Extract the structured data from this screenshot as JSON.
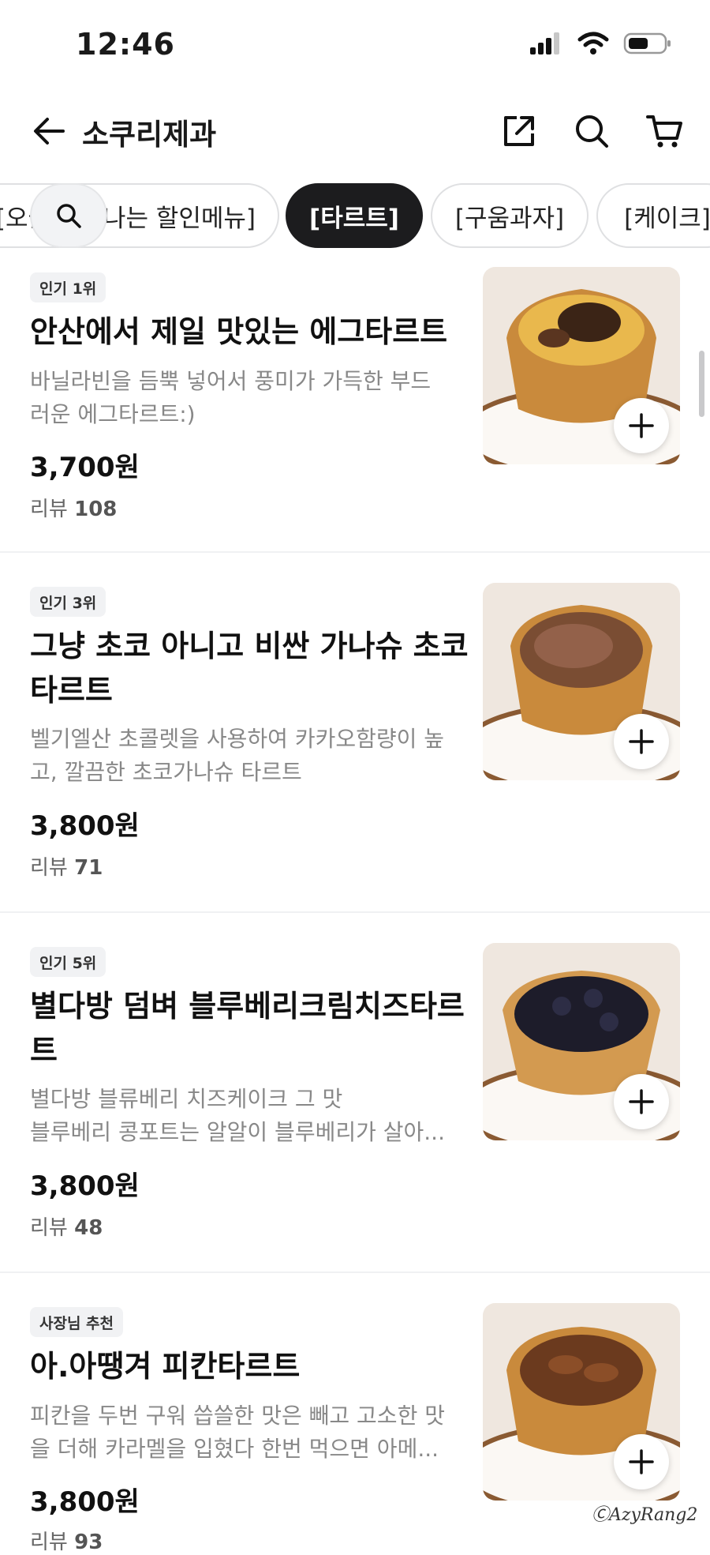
{
  "status_bar": {
    "time": "12:46"
  },
  "header": {
    "title": "소쿠리제과"
  },
  "chips": [
    {
      "label": "[오늘만 만나는 할인메뉴]",
      "active": false
    },
    {
      "label": "[타르트]",
      "active": true
    },
    {
      "label": "[구움과자]",
      "active": false
    },
    {
      "label": "[케이크]",
      "active": false
    }
  ],
  "items": [
    {
      "badge": "인기 1위",
      "name": "안산에서 제일 맛있는 에그타르트",
      "desc_line1": "바닐라빈을 듬뿍 넣어서 풍미가 가득한 부드",
      "desc_line2": "러운 에그타르트:)",
      "price": "3,700원",
      "reviews_label": "리뷰",
      "reviews_count": "108",
      "image_name": "egg-tart-image"
    },
    {
      "badge": "인기 3위",
      "name": "그냥 초코 아니고 비싼 가나슈 초코 타르트",
      "desc_line1": "벨기엘산 초콜렛을 사용하여 카카오함량이 높",
      "desc_line2": "고, 깔끔한 초코가나슈 타르트",
      "price": "3,800원",
      "reviews_label": "리뷰",
      "reviews_count": "71",
      "image_name": "choco-tart-image"
    },
    {
      "badge": "인기 5위",
      "name": "별다방 덤벼 블루베리크림치즈타르트",
      "desc_line1": "별다방 블류베리 치즈케이크 그 맛",
      "desc_line2": "블루베리 콩포트는 알알이 블루베리가 살아...",
      "price": "3,800원",
      "reviews_label": "리뷰",
      "reviews_count": "48",
      "image_name": "blueberry-tart-image"
    },
    {
      "badge": "사장님 추천",
      "name": "아.아땡겨 피칸타르트",
      "desc_line1": "피칸을 두번 구워 씁쓸한 맛은 빼고 고소한 맛",
      "desc_line2": "을 더해 카라멜을 입혔다 한번 먹으면 아메...",
      "price": "3,800원",
      "reviews_label": "리뷰",
      "reviews_count": "93",
      "image_name": "pecan-tart-image"
    }
  ],
  "watermark": "ⒸAzyRang2",
  "colors": {
    "active_chip": "#1c1c1e",
    "desc_text": "#888888",
    "badge_bg": "#f1f2f4"
  }
}
